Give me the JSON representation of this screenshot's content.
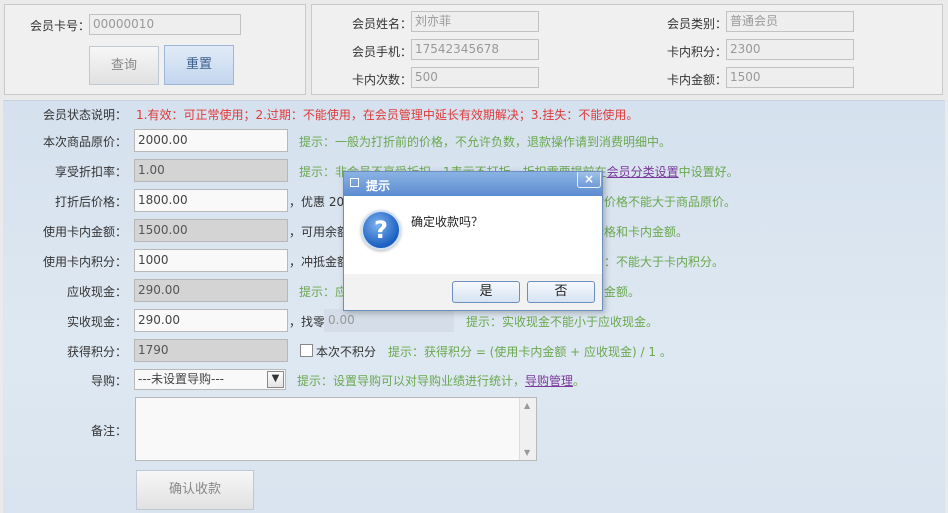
{
  "search": {
    "card_label": "会员卡号：",
    "card_value": "00000010",
    "query_btn": "查询",
    "reset_btn": "重置"
  },
  "member": {
    "name_label": "会员姓名：",
    "name_value": "刘亦菲",
    "phone_label": "会员手机：",
    "phone_value": "17542345678",
    "times_label": "卡内次数：",
    "times_value": "500",
    "type_label": "会员类别：",
    "type_value": "普通会员",
    "points_label": "卡内积分：",
    "points_value": "2300",
    "balance_label": "卡内金额：",
    "balance_value": "1500"
  },
  "form": {
    "status_label": "会员状态说明：",
    "status_text": "1.有效：可正常使用；2.过期：不能使用，在会员管理中延长有效期解决；3.挂失：不能使用。",
    "orig_label": "本次商品原价：",
    "orig_value": "2000.00",
    "orig_hint": "提示：一般为打折前的价格，不允许负数，退款操作请到消费明细中。",
    "disc_label": "享受折扣率：",
    "disc_value": "1.00",
    "disc_hint_pre": "提示：非会员不享受折扣，1表示不打折，折扣需要提前在",
    "disc_hint_link": "会员分类设置",
    "disc_hint_post": "中设置好。",
    "after_label": "打折后价格：",
    "after_value": "1800.00",
    "after_extra": "，优惠 20",
    "after_hint": "后价格不能大于商品原价。",
    "card_amt_label": "使用卡内金额：",
    "card_amt_value": "1500.00",
    "card_amt_extra": "，可用余额",
    "card_amt_hint": "价格和卡内金额。",
    "card_pts_label": "使用卡内积分：",
    "card_pts_value": "1000",
    "card_pts_extra": "，冲抵金额",
    "card_pts_hint": "示：不能大于卡内积分。",
    "due_label": "应收现金：",
    "due_value": "290.00",
    "due_hint_pre": "提示：应",
    "due_hint_post": "金额。",
    "recv_label": "实收现金：",
    "recv_value": "290.00",
    "change_label": "，找零",
    "change_value": "0.00",
    "recv_hint": "提示：实收现金不能小于应收现金。",
    "earn_label": "获得积分：",
    "earn_value": "1790",
    "no_points_label": "本次不积分",
    "earn_hint": "提示：获得积分 = (使用卡内金额 + 应收现金) / 1 。",
    "guide_label": "导购：",
    "guide_value": "---未设置导购---",
    "guide_hint_pre": "提示：设置导购可以对导购业绩进行统计，",
    "guide_hint_link": "导购管理",
    "guide_hint_post": "。",
    "remark_label": "备注：",
    "confirm_btn": "确认收款"
  },
  "dialog": {
    "title": "提示",
    "message": "确定收款吗？",
    "yes": "是",
    "no": "否",
    "close": "×"
  },
  "colors": {
    "hint": "#6aa84f",
    "warning": "#e03a3a",
    "dialog_title": "#5d8bd0"
  }
}
